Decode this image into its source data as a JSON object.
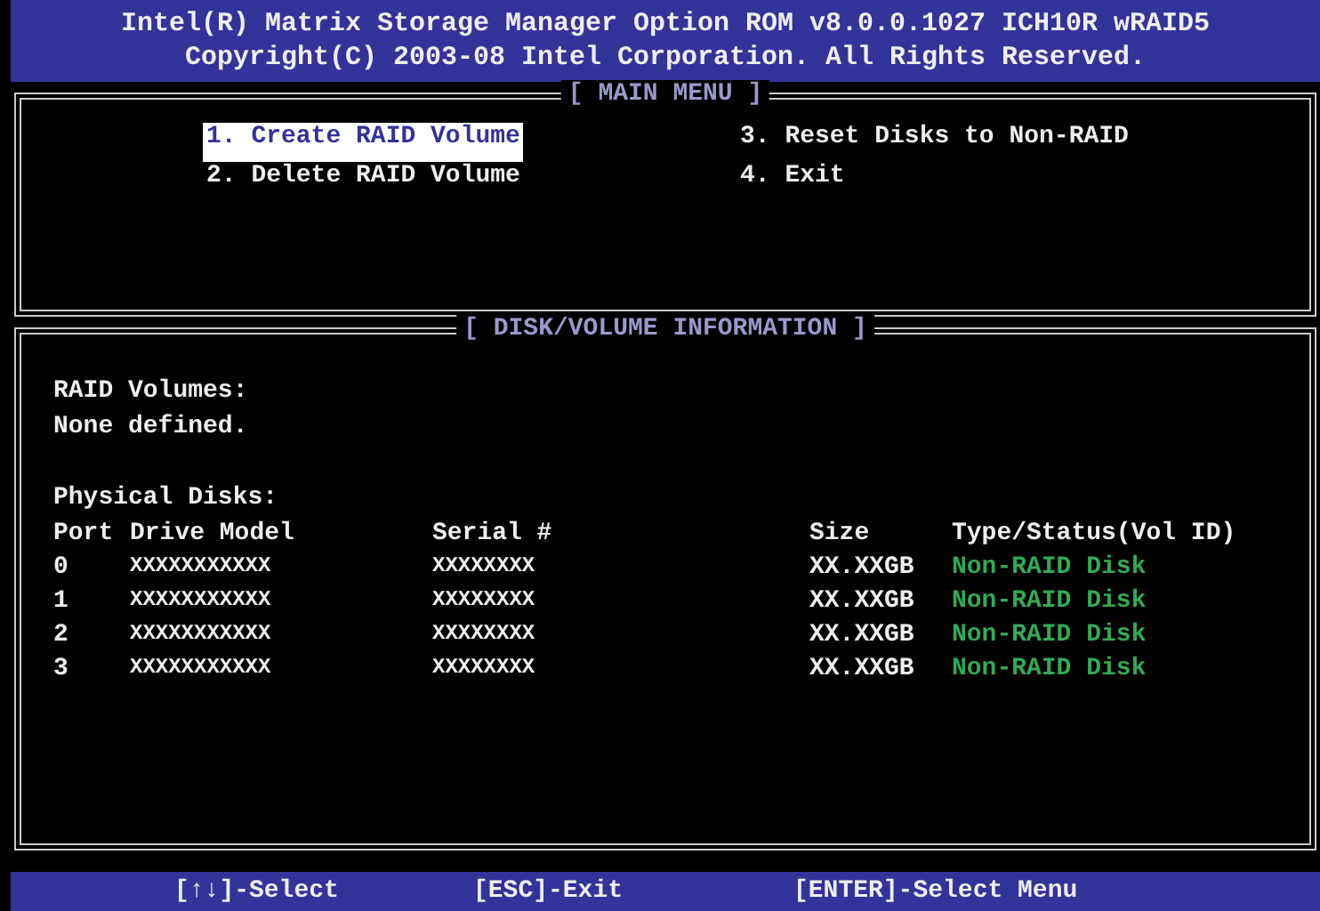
{
  "header": {
    "title": "Intel(R) Matrix Storage Manager Option ROM v8.0.0.1027 ICH10R wRAID5",
    "copyright": "Copyright(C) 2003-08 Intel Corporation. All Rights Reserved."
  },
  "main_menu": {
    "title": "[ MAIN MENU ]",
    "items": [
      {
        "label": "1. Create RAID Volume",
        "selected": true
      },
      {
        "label": "2. Delete RAID Volume",
        "selected": false
      },
      {
        "label": "3. Reset Disks to Non-RAID",
        "selected": false
      },
      {
        "label": "4. Exit",
        "selected": false
      }
    ]
  },
  "disk_info": {
    "title": "[ DISK/VOLUME INFORMATION ]",
    "raid_volumes_label": "RAID Volumes:",
    "raid_volumes_value": "None defined.",
    "physical_disks_label": "Physical Disks:",
    "columns": [
      "Port",
      "Drive Model",
      "Serial #",
      "Size",
      "Type/Status(Vol ID)"
    ],
    "rows": [
      {
        "port": "0",
        "model": "XXXXXXXXXXX",
        "serial": "XXXXXXXX",
        "size": "XX.XXGB",
        "status": "Non-RAID Disk"
      },
      {
        "port": "1",
        "model": "XXXXXXXXXXX",
        "serial": "XXXXXXXX",
        "size": "XX.XXGB",
        "status": "Non-RAID Disk"
      },
      {
        "port": "2",
        "model": "XXXXXXXXXXX",
        "serial": "XXXXXXXX",
        "size": "XX.XXGB",
        "status": "Non-RAID Disk"
      },
      {
        "port": "3",
        "model": "XXXXXXXXXXX",
        "serial": "XXXXXXXX",
        "size": "XX.XXGB",
        "status": "Non-RAID Disk"
      }
    ]
  },
  "footer": [
    "[↑↓]-Select",
    "[ESC]-Exit",
    "[ENTER]-Select Menu"
  ]
}
